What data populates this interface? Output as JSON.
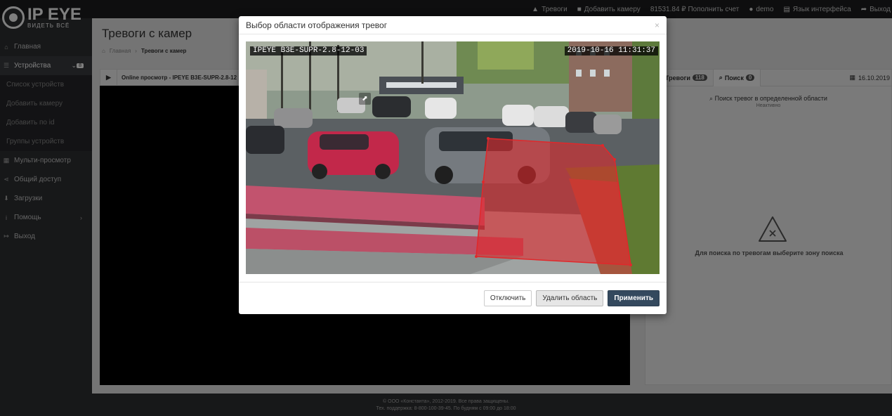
{
  "brand": {
    "logo_text": "IP EYE",
    "logo_tagline": "ВИДЕТЬ ВСЁ"
  },
  "topnav": [
    {
      "icon": "warning-icon",
      "label": "Тревоги"
    },
    {
      "icon": "camera-icon",
      "label": "Добавить камеру"
    },
    {
      "icon": "",
      "label": "81531.84 ₽ Пополнить счет"
    },
    {
      "icon": "user-icon",
      "label": "demo"
    },
    {
      "icon": "language-icon",
      "label": "Язык интерфейса"
    },
    {
      "icon": "logout-icon",
      "label": "Выход"
    }
  ],
  "sidebar": {
    "items": [
      {
        "icon": "home-icon",
        "label": "Главная"
      },
      {
        "icon": "list-icon",
        "label": "Устройства",
        "badge": "8"
      },
      {
        "icon": "grid-icon",
        "label": "Мульти-просмотр"
      },
      {
        "icon": "share-icon",
        "label": "Общий доступ"
      },
      {
        "icon": "download-icon",
        "label": "Загрузки"
      },
      {
        "icon": "info-icon",
        "label": "Помощь"
      },
      {
        "icon": "exit-icon",
        "label": "Выход"
      }
    ],
    "subitems": [
      "Список устройств",
      "Добавить камеру",
      "Добавить по id",
      "Группы устройств"
    ]
  },
  "page": {
    "title": "Тревоги с камер",
    "breadcrumb_home": "Главная",
    "breadcrumb_current": "Тревоги с камер"
  },
  "left_panel": {
    "title": "Online просмотр - IPEYE B3E-SUPR-2.8-12"
  },
  "right_panel": {
    "tab_alarms": "Тревоги",
    "tab_alarms_count": "118",
    "tab_search": "Поиск",
    "tab_search_count": "0",
    "date": "16.10.2019",
    "area_search": "Поиск тревог в определенной области",
    "area_search_status": "Неактивно",
    "hint": "Для поиска по тревогам выберите зону поиска"
  },
  "modal": {
    "title": "Выбор области отображения тревог",
    "close_glyph": "×",
    "osd_camera": "IPEYE B3E-SUPR-2.8-12-03",
    "osd_datetime": "2019-10-16 11:31:37",
    "btn_disable": "Отключить",
    "btn_delete": "Удалить область",
    "btn_apply": "Применить",
    "zone_color": "#e0282b"
  },
  "footer": {
    "line1": "© ООО «Константа», 2012-2019. Все права защищены.",
    "line2": "Тех. поддержка: 8-800-100-39-45. По будням с 09:00 до 18:00"
  }
}
